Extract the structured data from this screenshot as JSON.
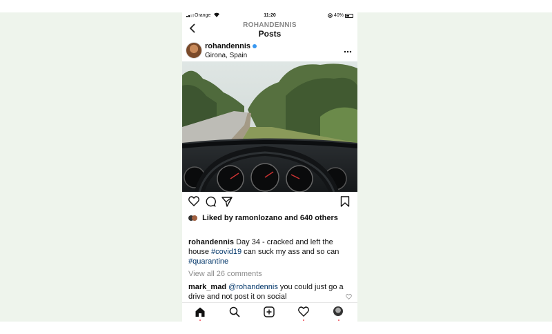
{
  "status_bar": {
    "carrier": "Orange",
    "time": "11:20",
    "battery": "40%"
  },
  "header": {
    "username": "ROHANDENNIS",
    "title": "Posts"
  },
  "post": {
    "username": "rohandennis",
    "location": "Girona, Spain",
    "likes_prefix": "Liked by",
    "likes_user": "ramonlozano",
    "likes_and": "and",
    "likes_count": "640 others",
    "caption_user": "rohandennis",
    "caption_text_1": "Day 34 - cracked and left the house",
    "caption_tag_1": "#covid19",
    "caption_text_2": "can suck my ass and so can",
    "caption_tag_2": "#quarantine",
    "view_comments": "View all 26 comments",
    "comment_user": "mark_mad",
    "comment_mention": "@rohandennis",
    "comment_text": "you could just go a drive and not post it on social"
  },
  "icons": {
    "back": "chevron-left-icon",
    "more": "more-icon",
    "like": "heart-icon",
    "comment": "comment-icon",
    "share": "share-icon",
    "save": "bookmark-icon",
    "home": "home-icon",
    "search": "search-icon",
    "add": "add-icon",
    "activity": "heart-icon",
    "profile": "avatar"
  },
  "colors": {
    "accent": "#3897f0",
    "hashtag": "#003569",
    "muted": "#8e8e8e",
    "notification_dot": "#ed4956"
  }
}
